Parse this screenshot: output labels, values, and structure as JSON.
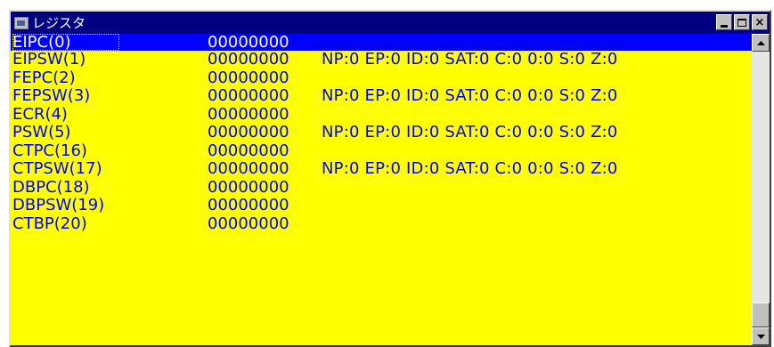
{
  "window": {
    "title": "レジスタ",
    "buttons": {
      "close": "×"
    }
  },
  "registers": [
    {
      "name": "EIPC(0)",
      "value": "00000000",
      "flags": ""
    },
    {
      "name": "EIPSW(1)",
      "value": "00000000",
      "flags": "NP:0 EP:0 ID:0 SAT:0 C:0 0:0 S:0 Z:0"
    },
    {
      "name": "FEPC(2)",
      "value": "00000000",
      "flags": ""
    },
    {
      "name": "FEPSW(3)",
      "value": "00000000",
      "flags": "NP:0 EP:0 ID:0 SAT:0 C:0 0:0 S:0 Z:0"
    },
    {
      "name": "ECR(4)",
      "value": "00000000",
      "flags": ""
    },
    {
      "name": "PSW(5)",
      "value": "00000000",
      "flags": "NP:0 EP:0 ID:0 SAT:0 C:0 0:0 S:0 Z:0"
    },
    {
      "name": "CTPC(16)",
      "value": "00000000",
      "flags": ""
    },
    {
      "name": "CTPSW(17)",
      "value": "00000000",
      "flags": "NP:0 EP:0 ID:0 SAT:0 C:0 0:0 S:0 Z:0"
    },
    {
      "name": "DBPC(18)",
      "value": "00000000",
      "flags": ""
    },
    {
      "name": "DBPSW(19)",
      "value": "00000000",
      "flags": ""
    },
    {
      "name": "CTBP(20)",
      "value": "00000000",
      "flags": ""
    }
  ],
  "selected_row": "EIPC(0)",
  "colors": {
    "list_background": "#ffff00",
    "text": "#0000ff",
    "selection": "#0000ff",
    "title_bar": "#000080"
  },
  "scrollbar": {
    "up_icon": "scroll-up-arrow",
    "down_icon": "scroll-down-arrow"
  }
}
